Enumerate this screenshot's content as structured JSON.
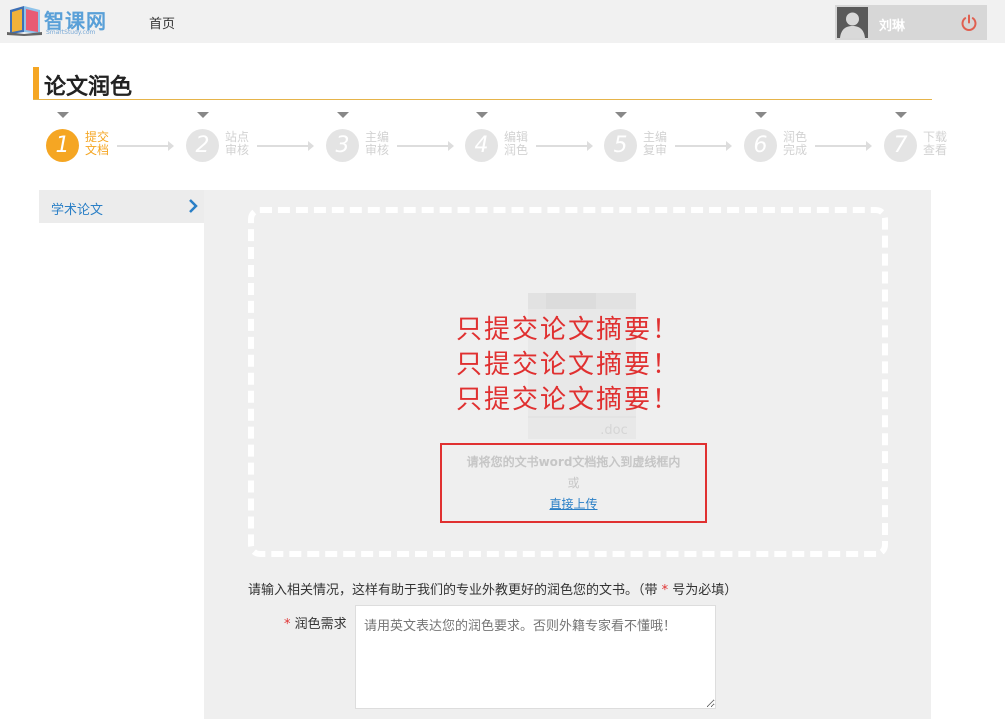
{
  "header": {
    "logo_text": "智课网",
    "logo_sub": "SmartStudy.com",
    "nav_home": "首页",
    "username": "刘琳",
    "power_icon": "power-icon"
  },
  "page": {
    "title": "论文润色"
  },
  "steps": [
    {
      "num": "1",
      "label": "提交文档",
      "active": true
    },
    {
      "num": "2",
      "label": "站点审核",
      "active": false
    },
    {
      "num": "3",
      "label": "主编审核",
      "active": false
    },
    {
      "num": "4",
      "label": "编辑润色",
      "active": false
    },
    {
      "num": "5",
      "label": "主编复审",
      "active": false
    },
    {
      "num": "6",
      "label": "润色完成",
      "active": false
    },
    {
      "num": "7",
      "label": "下载查看",
      "active": false
    }
  ],
  "sidebar": {
    "items": [
      {
        "label": "学术论文",
        "icon": "chevron-right-icon"
      }
    ]
  },
  "upload": {
    "doc_ext": ".doc",
    "warnings": [
      "只提交论文摘要！",
      "只提交论文摘要！",
      "只提交论文摘要！"
    ],
    "hint_drag": "请将您的文书word文档拖入到虚线框内",
    "hint_or": "或",
    "hint_upload_link": "直接上传"
  },
  "form": {
    "note_prefix": "请输入相关情况，这样有助于我们的专业外教更好的润色您的文书。（带 ",
    "note_star": "*",
    "note_suffix": " 号为必填）",
    "field_star": "*",
    "field_label": "润色需求",
    "textarea_placeholder": "请用英文表达您的润色要求。否则外籍专家看不懂哦！"
  },
  "colors": {
    "accent": "#f5a623",
    "link": "#2a7fc6",
    "warning": "#e03030"
  }
}
